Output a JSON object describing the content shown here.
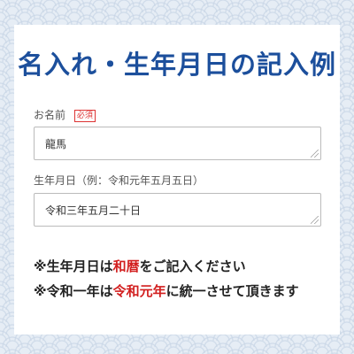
{
  "title": "名入れ・生年月日の記入例",
  "name_field": {
    "label": "お名前",
    "required_badge": "必須",
    "value": "龍馬"
  },
  "birth_field": {
    "label": "生年月日（例：令和元年五月五日）",
    "value": "令和三年五月二十日"
  },
  "notes": {
    "line1_prefix": "※生年月日は",
    "line1_highlight": "和暦",
    "line1_suffix": "をご記入ください",
    "line2_prefix": "※令和一年は",
    "line2_highlight": "令和元年",
    "line2_suffix": "に統一させて頂きます"
  },
  "colors": {
    "title": "#1c4f9c",
    "highlight": "#d21f1f",
    "background_pattern": "#c9d6e6"
  }
}
